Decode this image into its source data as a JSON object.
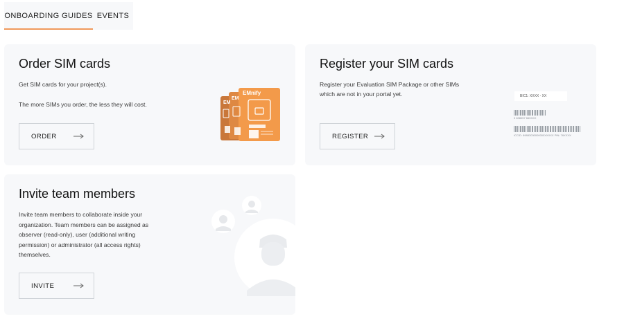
{
  "tabs": [
    {
      "label": "ONBOARDING GUIDES",
      "active": true
    },
    {
      "label": "EVENTS",
      "active": false
    }
  ],
  "cards": {
    "order": {
      "title": "Order SIM cards",
      "text_1": "Get SIM cards for your project(s).",
      "text_2": "The more SIMs you order, the less they will cost.",
      "button": "ORDER",
      "brand": "EMnify"
    },
    "register": {
      "title": "Register your SIM cards",
      "text_1": "Register your Evaluation SIM Package or other SIMs",
      "text_2": "which are not in your portal yet.",
      "button": "REGISTER",
      "bic_field": "BIC1: XXXX - XX",
      "code_1": "0 638057 660XXX",
      "code_2": "ICCID: 89883030000000XXXXX PIN: 76XXXX"
    },
    "invite": {
      "title": "Invite team members",
      "text_1": "Invite team members to collaborate inside your",
      "text_2": "organization. Team members can be assigned as",
      "text_3": "observer (read-only), user (additional writing",
      "text_4": "permission) or administrator (all access rights)",
      "text_5": "themselves.",
      "button": "INVITE"
    }
  },
  "colors": {
    "accent": "#f0985a",
    "sim_orange": "#f39a4a",
    "card_bg": "#f7f8fa"
  },
  "icons": [
    "arrow-right-icon",
    "sim-card-icon",
    "barcode-icon",
    "avatar-icon"
  ]
}
